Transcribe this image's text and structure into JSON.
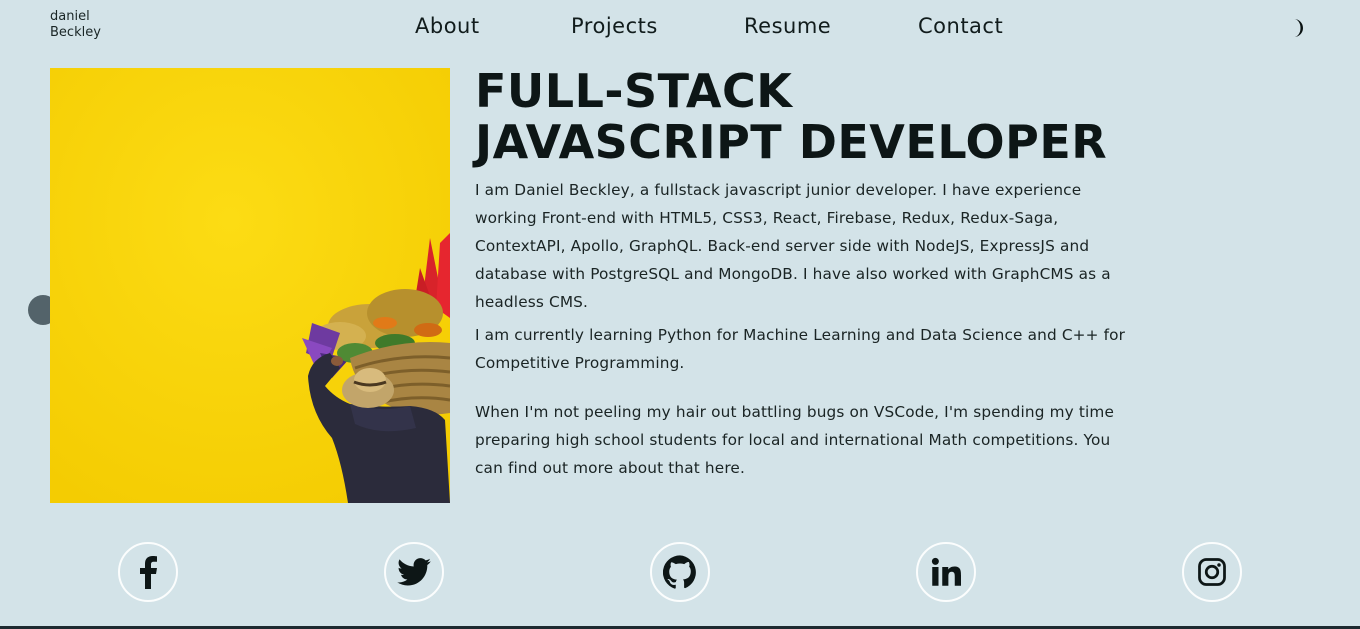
{
  "logo": {
    "line1": "daniel",
    "line2": "Beckley"
  },
  "nav": {
    "about": "About",
    "projects": "Projects",
    "resume": "Resume",
    "contact": "Contact"
  },
  "theme_toggle_icon": "crescent-moon-icon",
  "hero": {
    "headline_line1": "FULL-STACK",
    "headline_line2": "JAVASCRIPT DEVELOPER",
    "paragraph1": "I am Daniel Beckley, a fullstack javascript junior developer. I have experience working Front-end with HTML5, CSS3, React, Firebase, Redux, Redux-Saga, ContextAPI, Apollo, GraphQL. Back-end server side with NodeJS, ExpressJS and database with PostgreSQL and MongoDB. I have also worked with GraphCMS as a headless CMS.",
    "paragraph2": "I am currently learning Python for Machine Learning and Data Science and C++ for Competitive Programming.",
    "paragraph3": "When I'm not peeling my hair out battling bugs on VSCode, I'm spending my time preparing high school students for local and international Math competitions. You can find out more about that here."
  },
  "socials": [
    {
      "icon": "facebook-icon"
    },
    {
      "icon": "twitter-icon"
    },
    {
      "icon": "github-icon"
    },
    {
      "icon": "linkedin-icon"
    },
    {
      "icon": "instagram-icon"
    }
  ],
  "colors": {
    "background": "#d3e3e8",
    "image_yellow": "#f8d30a",
    "text_dark": "#0d1616",
    "side_dot": "#53636a"
  }
}
